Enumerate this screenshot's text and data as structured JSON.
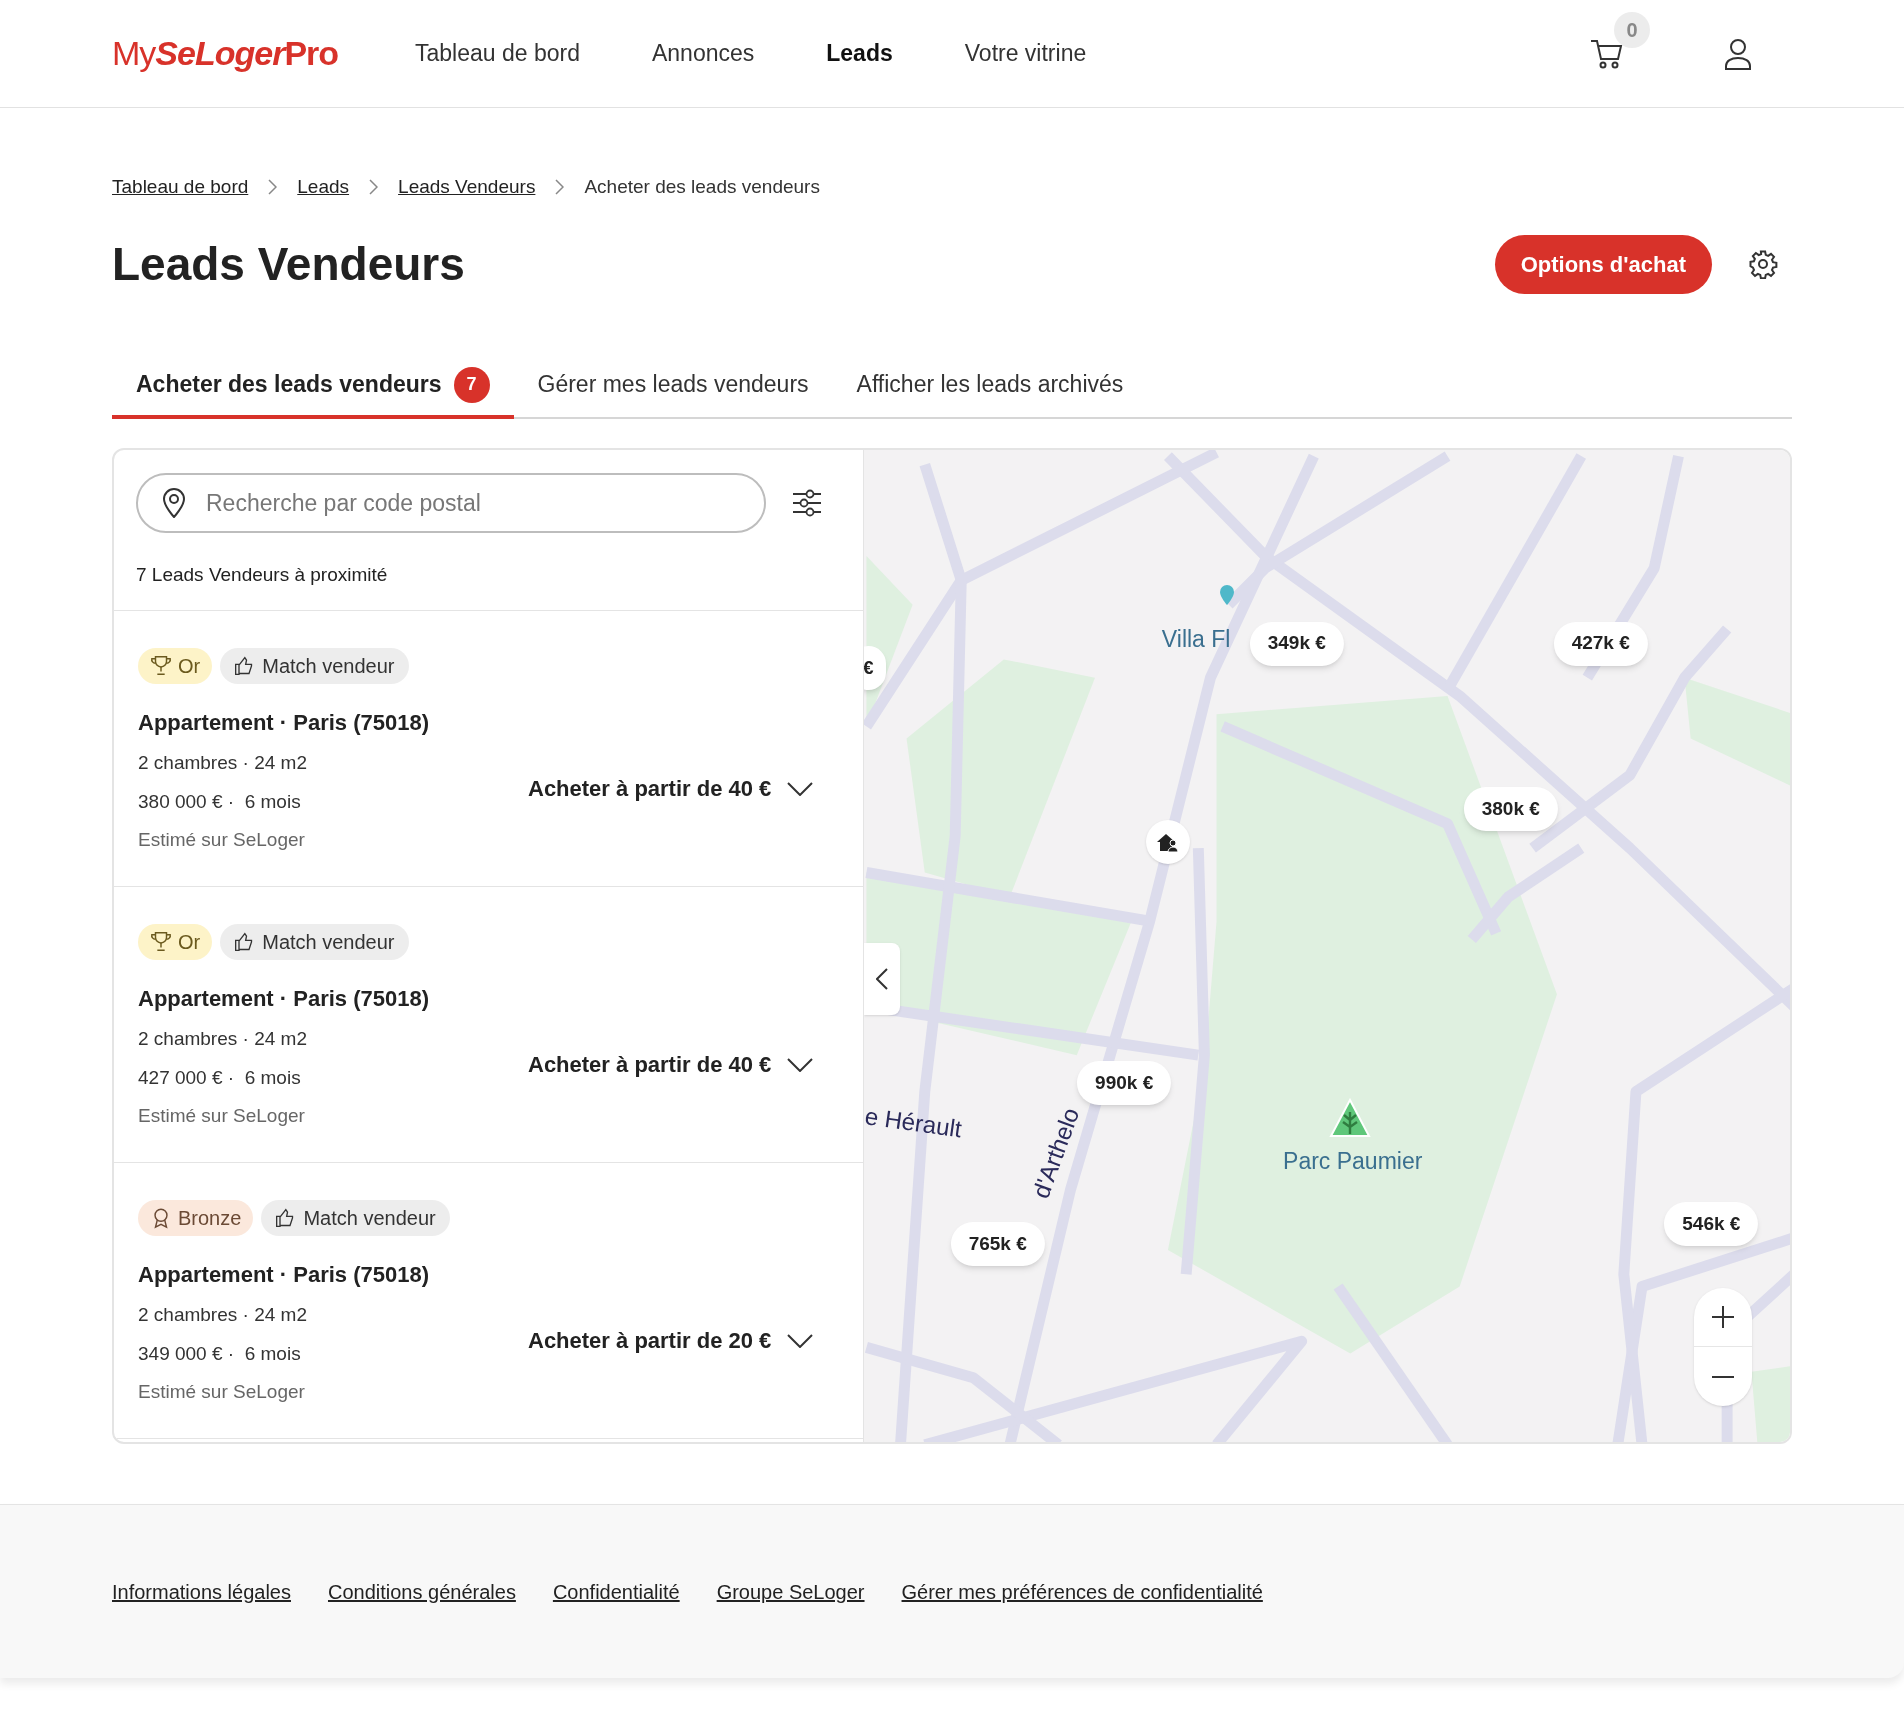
{
  "header": {
    "logo": {
      "prefix": "My",
      "brand": "SeLoger",
      "suffix": "Pro"
    },
    "nav": [
      {
        "label": "Tableau de bord",
        "selected": false
      },
      {
        "label": "Annonces",
        "selected": false
      },
      {
        "label": "Leads",
        "selected": true
      },
      {
        "label": "Votre vitrine",
        "selected": false
      }
    ],
    "cart_count": "0"
  },
  "breadcrumb": [
    {
      "label": "Tableau de bord",
      "kind": "link"
    },
    {
      "label": "Leads",
      "kind": "link"
    },
    {
      "label": "Leads Vendeurs",
      "kind": "link"
    },
    {
      "label": "Acheter des leads vendeurs",
      "kind": "current"
    }
  ],
  "page_title": "Leads Vendeurs",
  "primary_button": "Options d'achat",
  "tabs": [
    {
      "label": "Acheter des leads vendeurs",
      "selected": true,
      "badge": "7"
    },
    {
      "label": "Gérer mes leads vendeurs",
      "selected": false
    },
    {
      "label": "Afficher les leads archivés",
      "selected": false
    }
  ],
  "search": {
    "placeholder": "Recherche par code postal"
  },
  "results_count": "7 Leads Vendeurs à proximité",
  "leads": [
    {
      "tier": {
        "label": "Or",
        "kind": "gold"
      },
      "match": "Match vendeur",
      "title": "Appartement · Paris (75018)",
      "details": "2 chambres · 24 m2",
      "price_line": "380 000 € ·  6 mois",
      "estimate": "Estimé sur SeLoger",
      "action": "Acheter à partir de 40 €"
    },
    {
      "tier": {
        "label": "Or",
        "kind": "gold"
      },
      "match": "Match vendeur",
      "title": "Appartement · Paris (75018)",
      "details": "2 chambres · 24 m2",
      "price_line": "427 000 € ·  6 mois",
      "estimate": "Estimé sur SeLoger",
      "action": "Acheter à partir de 40 €"
    },
    {
      "tier": {
        "label": "Bronze",
        "kind": "bronze"
      },
      "match": "Match vendeur",
      "title": "Appartement · Paris (75018)",
      "details": "2 chambres · 24 m2",
      "price_line": "349 000 € ·  6 mois",
      "estimate": "Estimé sur SeLoger",
      "action": "Acheter à partir de 20 €"
    }
  ],
  "map": {
    "price_pins": [
      {
        "label": "€"
      },
      {
        "label": "349k €"
      },
      {
        "label": "427k €"
      },
      {
        "label": "380k €"
      },
      {
        "label": "990k €"
      },
      {
        "label": "765k €"
      },
      {
        "label": "546k €"
      }
    ],
    "place_labels": [
      {
        "label": "Villa Fl",
        "kind": "place"
      },
      {
        "label": "e Hérault",
        "kind": "street"
      },
      {
        "label": "d'Arthelo",
        "kind": "street-vertical"
      },
      {
        "label": "Parc Paumier",
        "kind": "park"
      }
    ]
  },
  "footer_links": [
    "Informations légales",
    "Conditions générales",
    "Confidentialité",
    "Groupe SeLoger",
    "Gérer mes préférences de confidentialité"
  ]
}
